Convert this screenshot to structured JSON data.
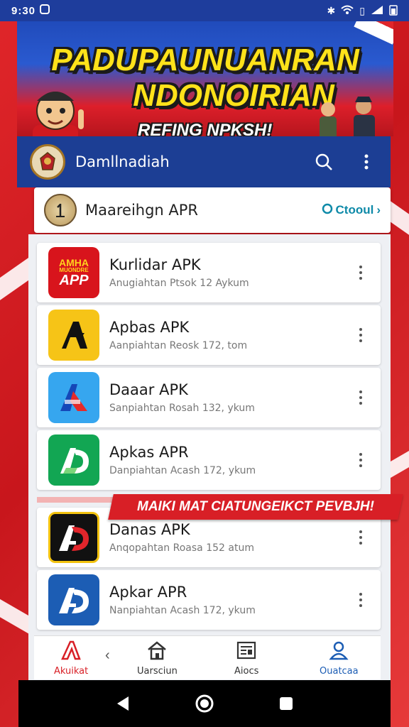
{
  "status_bar": {
    "time": "9:30"
  },
  "banner": {
    "title_line1": "PADUPAUNUANRAN",
    "title_line2": "NDONOIRIAN",
    "subtitle": "REFING NPKSH!"
  },
  "app_bar": {
    "title": "Damllnadiah"
  },
  "featured": {
    "name": "Maareihgn APR",
    "action_label": "Ctooul"
  },
  "apps": [
    {
      "name": "Kurlidar APK",
      "subtitle": "Anugiahtan Ptsok 12 Aykum",
      "icon": "amha-app-icon",
      "icon_text_top": "AMHA",
      "icon_text_mid": "MUONDRE",
      "icon_text_bottom": "APP",
      "color": "#d8141c"
    },
    {
      "name": "Apbas APK",
      "subtitle": "Aanpiahtan Reosk 172, tom",
      "icon": "black-a-logo-icon",
      "color": "#f6c417"
    },
    {
      "name": "Daaar APK",
      "subtitle": "Sanpiahtan Rosah 132, ykum",
      "icon": "blue-a-logo-icon",
      "color": "#36a6ef"
    },
    {
      "name": "Apkas APR",
      "subtitle": "Danpiahtan Acash 172, ykum",
      "icon": "green-ad-logo-icon",
      "color": "#12a653"
    },
    {
      "name": "Danas APK",
      "subtitle": "Anqopahtan Roasa 152 atum",
      "icon": "red-black-ad-logo-icon",
      "color": "#111111"
    },
    {
      "name": "Apkar APR",
      "subtitle": "Nanpiahtan Acash 172, ykum",
      "icon": "blue-ad-logo-icon",
      "color": "#1c5db4"
    }
  ],
  "promo": {
    "text": "MAIKI MAT CIATUNGEIKCT PEVBJH!"
  },
  "bottom_nav": {
    "items": [
      {
        "label": "Akuikat",
        "icon": "a-logo-icon",
        "active": true
      },
      {
        "label": "Uarsciun",
        "icon": "house-icon",
        "active": false
      },
      {
        "label": "Aiocs",
        "icon": "newspaper-icon",
        "active": false
      },
      {
        "label": "Ouatcaa",
        "icon": "person-icon",
        "active": false
      }
    ]
  },
  "colors": {
    "brand_blue": "#1c3e94",
    "brand_red": "#d81f26",
    "banner_yellow": "#ffe21a",
    "accent_teal": "#0e8aa8"
  }
}
